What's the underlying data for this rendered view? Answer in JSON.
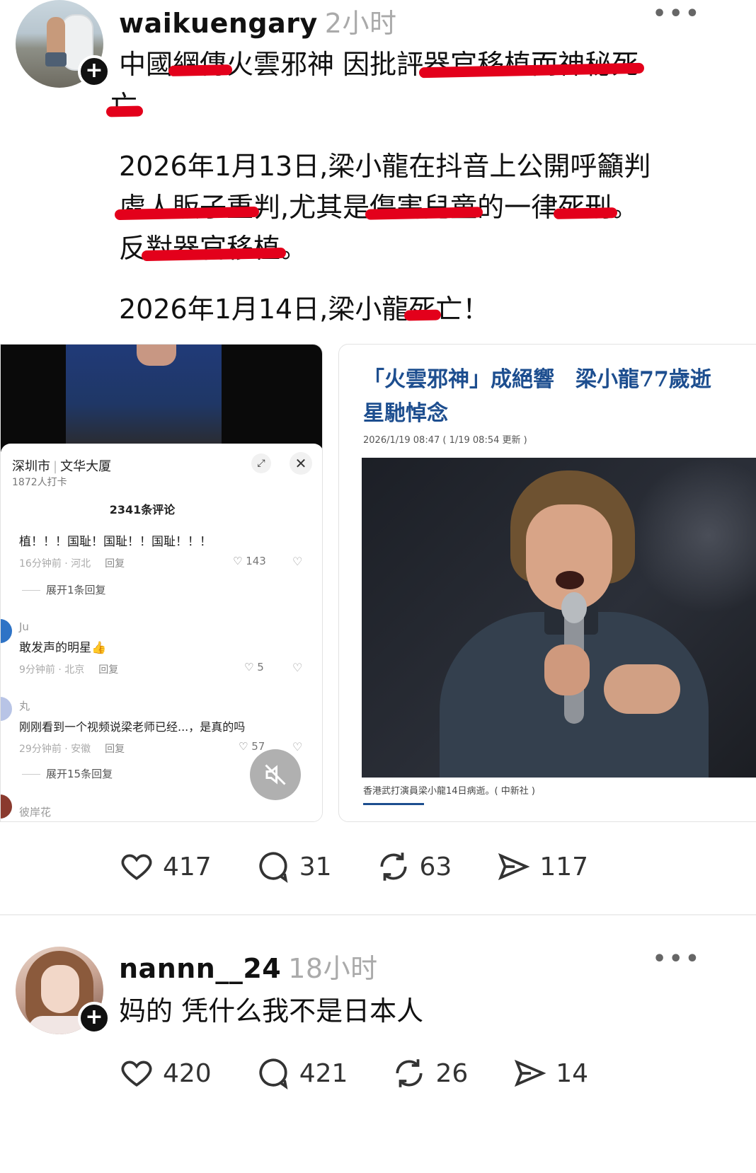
{
  "posts": [
    {
      "username": "waikuengary",
      "time": "2小时",
      "text": {
        "p1_a": "中國",
        "p1_b": "網傳",
        "p1_c": "火雲邪神 因批評",
        "p1_d": "器官移植而神秘死",
        "p1_e": "亡",
        "p2_a": "2026年1月13日,梁小龍在抖音上公開呼籲判",
        "p2_b": "處人販子重",
        "p2_c": "判,尤其是",
        "p2_d": "傷害兒童",
        "p2_e": "的一律",
        "p2_f": "死刑",
        "p2_g": "。",
        "p2_h": "反",
        "p2_i": "對器官移植",
        "p2_j": "。",
        "p3_a": "2026年1月14日,梁小龍",
        "p3_b": "死",
        "p3_c": "亡！"
      },
      "actions": {
        "likes": "417",
        "comments": "31",
        "reposts": "63",
        "shares": "117"
      }
    },
    {
      "username": "nannn__24",
      "time": "18小时",
      "text": "妈的 凭什么我不是日本人",
      "actions": {
        "likes": "420",
        "comments": "421",
        "reposts": "26",
        "shares": "14"
      }
    }
  ],
  "embedded_left": {
    "location": "深圳市",
    "place": "文华大厦",
    "checkins": "1872人打卡",
    "comment_count": "2341条评论",
    "comments": [
      {
        "author": "",
        "text": "植！！！国耻！国耻！！国耻！！！",
        "meta": "16分钟前 · 河北",
        "reply": "回复",
        "likes": "143",
        "expand": "展开1条回复"
      },
      {
        "author": "Ju",
        "text": "敢发声的明星👍",
        "meta": "9分钟前 · 北京",
        "reply": "回复",
        "likes": "5"
      },
      {
        "author": "丸",
        "text": "刚刚看到一个视频说梁老师已经...，是真的吗",
        "meta": "29分钟前 · 安徽",
        "reply": "回复",
        "likes": "57",
        "expand": "展开15条回复"
      }
    ],
    "last_author": "彼岸花"
  },
  "embedded_right": {
    "headline": "「火雲邪神」成絕響　梁小龍77歲逝\n星馳悼念",
    "date": "2026/1/19 08:47 ( 1/19 08:54 更新 )",
    "caption": "香港武打演員梁小龍14日病逝。( 中新社 )"
  }
}
